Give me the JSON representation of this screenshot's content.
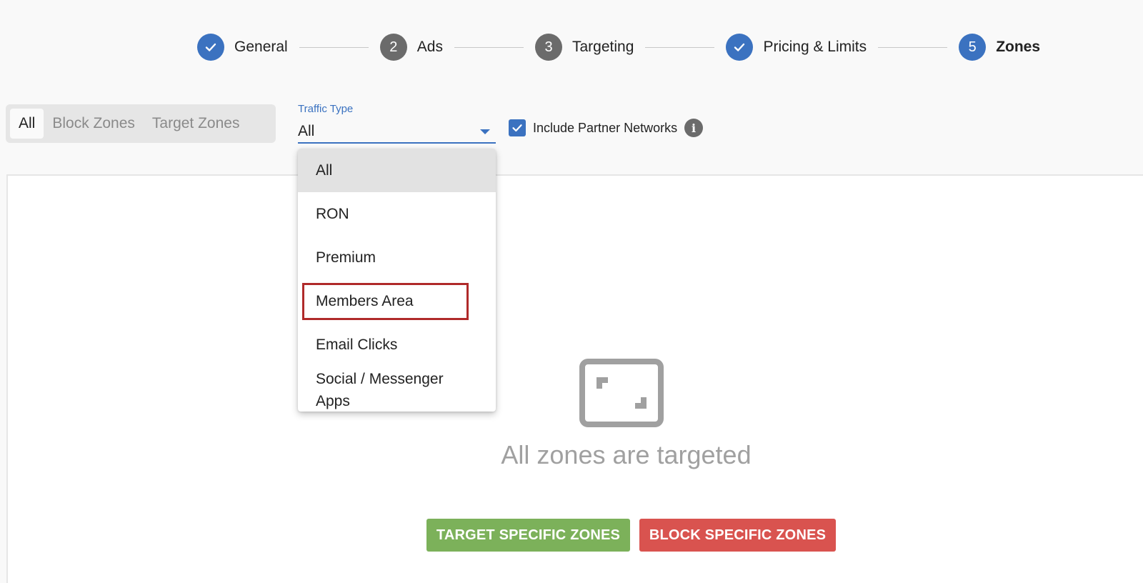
{
  "stepper": {
    "steps": [
      {
        "label": "General",
        "number": "",
        "state": "done"
      },
      {
        "label": "Ads",
        "number": "2",
        "state": "pending"
      },
      {
        "label": "Targeting",
        "number": "3",
        "state": "pending"
      },
      {
        "label": "Pricing & Limits",
        "number": "",
        "state": "done"
      },
      {
        "label": "Zones",
        "number": "5",
        "state": "active"
      }
    ]
  },
  "zone_filter": {
    "options": [
      "All",
      "Block Zones",
      "Target Zones"
    ],
    "selected": "All"
  },
  "traffic_type": {
    "label": "Traffic Type",
    "value": "All",
    "options": [
      "All",
      "RON",
      "Premium",
      "Members Area",
      "Email Clicks",
      "Social / Messenger Apps"
    ],
    "highlighted": "Members Area"
  },
  "partner_networks": {
    "label": "Include Partner Networks",
    "checked": true,
    "info_icon": "info-icon"
  },
  "empty_state": {
    "icon": "expand-icon",
    "message": "All zones are targeted"
  },
  "actions": {
    "target_label": "TARGET SPECIFIC ZONES",
    "block_label": "BLOCK SPECIFIC ZONES"
  },
  "colors": {
    "primary": "#3b72c0",
    "pending": "#6b6b6b",
    "success": "#7cb15a",
    "danger": "#d9534f",
    "highlight": "#b02a2a"
  }
}
